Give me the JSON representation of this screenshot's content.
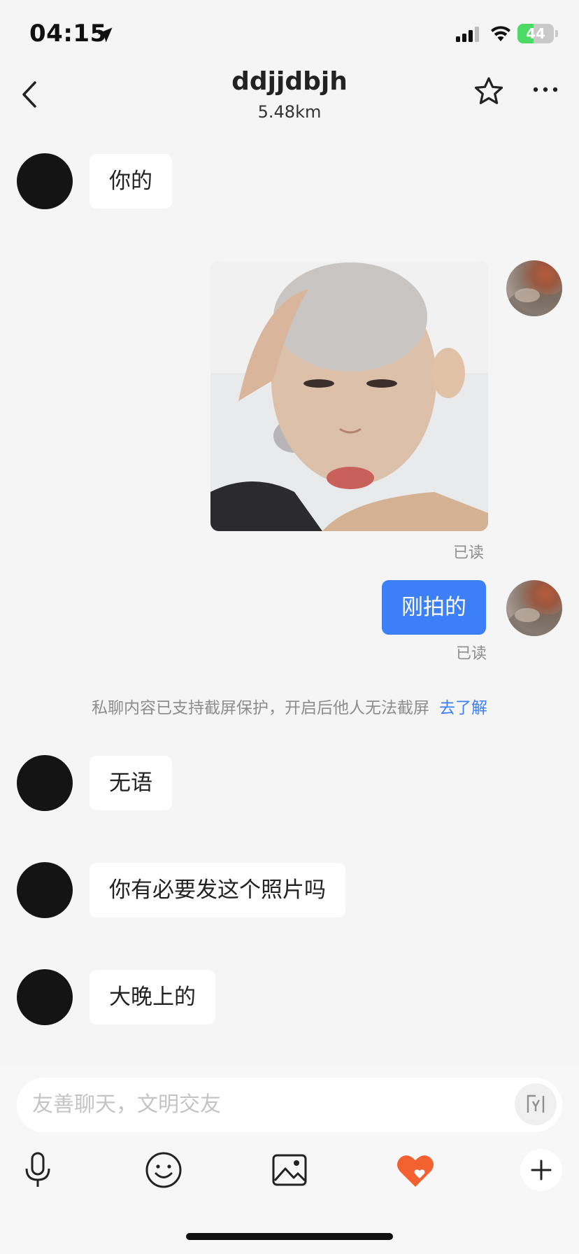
{
  "status_bar": {
    "time": "04:15",
    "battery_level": "44",
    "battery_fraction": 0.44
  },
  "header": {
    "title": "ddjjdbjh",
    "distance": "5.48km"
  },
  "messages": [
    {
      "side": "left",
      "text": "你的"
    },
    {
      "side": "right",
      "type": "image",
      "status": "已读"
    },
    {
      "side": "right",
      "text": "刚拍的",
      "status": "已读"
    },
    {
      "side": "left",
      "text": "无语"
    },
    {
      "side": "left",
      "text": "你有必要发这个照片吗"
    },
    {
      "side": "left",
      "text": "大晚上的"
    }
  ],
  "notice": {
    "text": "私聊内容已支持截屏保护，开启后他人无法截屏",
    "link": "去了解"
  },
  "input": {
    "placeholder": "友善聊天，文明交友"
  },
  "colors": {
    "accent": "#3d7ff6",
    "background": "#f5f5f5",
    "heart": "#f2612f"
  },
  "icons": [
    "location-arrow-icon",
    "signal-icon",
    "wifi-icon",
    "back-arrow-icon",
    "star-icon",
    "more-icon",
    "flash-icon",
    "microphone-icon",
    "emoji-icon",
    "image-icon",
    "heart-icon",
    "plus-icon"
  ]
}
